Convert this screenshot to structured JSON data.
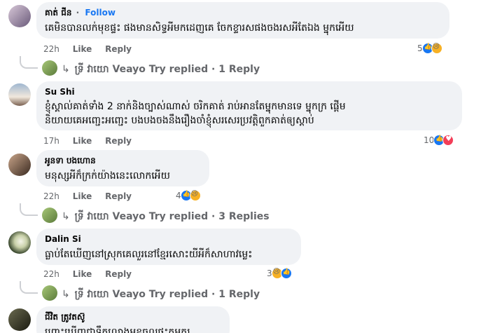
{
  "comments": [
    {
      "author": "គាត់ ជីន",
      "follow": "Follow",
      "text": [
        "គេមិនបានលក់មុខផ្ទះ ផងមានសិទ្ធអីមកដេញគេ ចែកខ្ទារសផងចងរសអីតែឯង ម្នុកអើយ"
      ],
      "time": "22h",
      "like": "Like",
      "reply": "Reply",
      "reaction_count": "5",
      "reply_summary": {
        "name": "ទ្រី វាយោ",
        "text": "Veayo Try replied · 1 Reply"
      }
    },
    {
      "author": "Su Shi",
      "text": [
        "ខ្ញុំស្គាល់គាត់ទាំង 2 នាក់និងច្បាស់ណាស់ ចរិកគាត់ រាប់អានតែម្នុកមានទេ ម្នុកក្រ ផ្តើម",
        "និយាយគេអញ្ជេះអញ្ជេះ បងបងចងនឹងរឿងចាំខ្ញុំសរសេរប្រវត្តិពួកគាត់ឲ្យស្តាប់"
      ],
      "time": "17h",
      "like": "Like",
      "reply": "Reply",
      "reaction_count": "10"
    },
    {
      "author": "អូនទា បងហោន",
      "text": [
        "មនុស្សអីក៏ក្រក់យ៉ាងនេះលោកអើយ"
      ],
      "time": "22h",
      "like": "Like",
      "reply": "Reply",
      "reaction_count": "4",
      "reply_summary": {
        "name": "ទ្រី វាយោ",
        "text": "Veayo Try replied · 3 Replies"
      }
    },
    {
      "author": "Dalin Si",
      "text": [
        "ធ្លាប់តែឃើញនៅស្រុកគេលួរនៅខ្មែរសោះយីអីក៏សាហាវម្លេះ"
      ],
      "time": "22h",
      "like": "Like",
      "reply": "Reply",
      "reaction_count": "3",
      "reply_summary": {
        "name": "ទ្រី វាយោ",
        "text": "Veayo Try replied · 1 Reply"
      }
    },
    {
      "author": "ជីវិត ត្រូវតស៊ូ",
      "text": [
        "ព្រោះឃើញជាទឹកលោងមុខចូលផ្ទះកម្មករ"
      ]
    }
  ],
  "colors": {
    "accent": "#1877f2",
    "bubble": "#f0f2f5",
    "muted": "#65676b"
  },
  "icons": [
    "like-reaction-icon",
    "sad-reaction-icon",
    "love-reaction-icon"
  ]
}
